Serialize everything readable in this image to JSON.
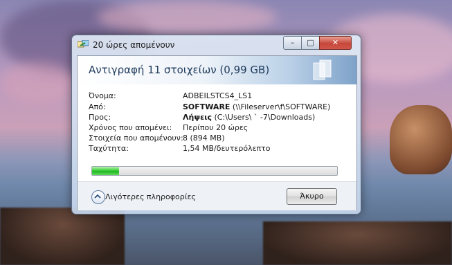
{
  "window": {
    "title": "20 ώρες απομένουν",
    "controls": {
      "minimize": "–",
      "maximize": "□",
      "close": "✕"
    }
  },
  "header": {
    "title": "Αντιγραφή 11 στοιχείων (0,99 GB)"
  },
  "details": {
    "name_label": "Όνομα:",
    "name_value": "ADBEILSTCS4_LS1",
    "from_label": "Από:",
    "from_bold": "SOFTWARE",
    "from_rest": " (\\\\Fileserver\\f\\SOFTWARE)",
    "to_label": "Προς:",
    "to_bold": "Λήψεις",
    "to_rest": " (C:\\Users\\  `     -7\\Downloads)",
    "time_label": "Χρόνος που απομένει:",
    "time_value": "Περίπου 20 ώρες",
    "items_label": "Στοιχεία που απομένουν:",
    "items_value": "8 (894 MB)",
    "speed_label": "Ταχύτητα:",
    "speed_value": "1,54 MB/δευτερόλεπτο"
  },
  "progress": {
    "fraction": 0.11
  },
  "footer": {
    "less_info_label": "Λιγότερες πληροφορίες",
    "cancel_label": "Άκυρο"
  },
  "colors": {
    "progress": "#22b522",
    "header_text": "#1e3a5a",
    "close_button": "#c6463a"
  }
}
